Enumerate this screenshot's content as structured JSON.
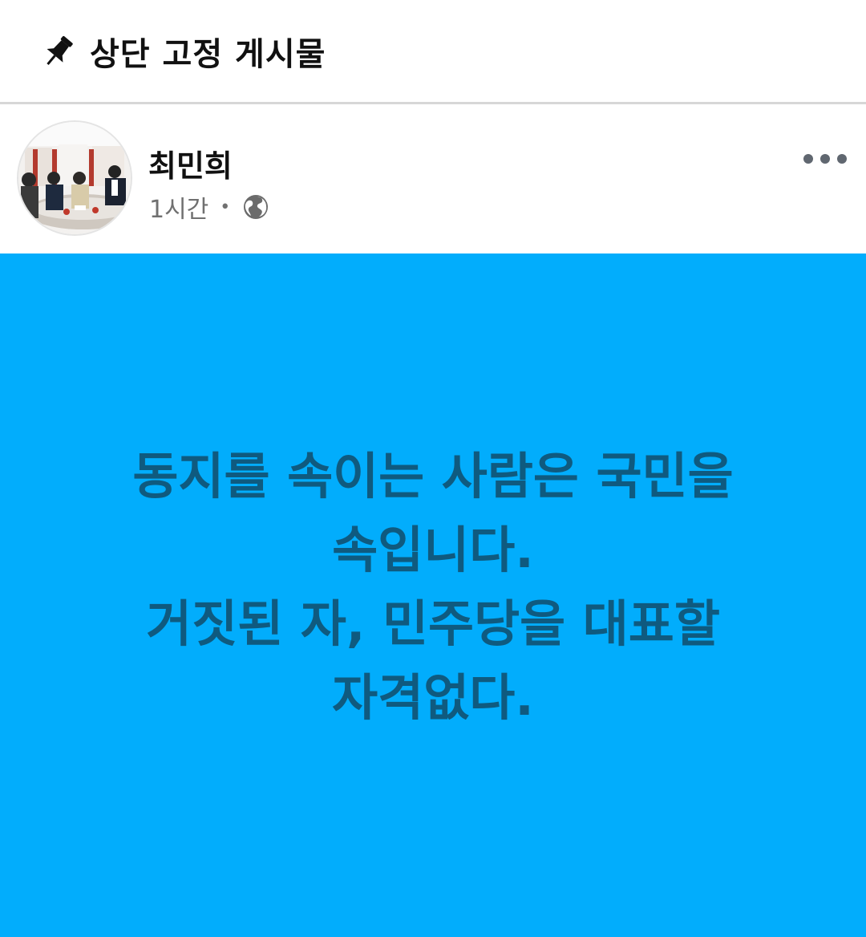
{
  "pinned": {
    "title": "상단 고정 게시물",
    "icon": "pin-icon"
  },
  "post": {
    "author": "최민희",
    "time": "1시간",
    "separator": "•",
    "privacy_icon": "globe-icon",
    "more_icon": "more-options-icon",
    "avatar_description": "profile-photo",
    "background_color": "#02adfc",
    "text_color": "#0f5a7f",
    "text_lines": [
      "동지를 속이는 사람은 국민을",
      "속입니다.",
      "거짓된 자, 민주당을 대표할",
      "자격없다."
    ]
  }
}
